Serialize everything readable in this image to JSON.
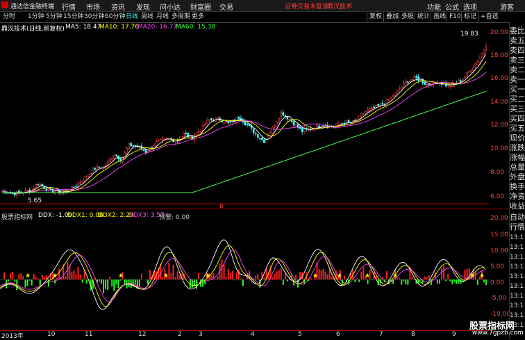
{
  "app": {
    "name": "通达信金融终端",
    "menus": [
      "行情",
      "市场",
      "资讯",
      "发现",
      "问小达",
      "财富圈",
      "交易"
    ],
    "notice": "证券交易未登录",
    "stock_link": "鼎汉技术",
    "right_menus": [
      "功能",
      "公式",
      "选项",
      "游客"
    ]
  },
  "periods": [
    "分时",
    "1分钟",
    "5分钟",
    "15分钟",
    "30分钟",
    "60分钟",
    "日线",
    "周线",
    "月线",
    "多周期",
    "更多"
  ],
  "active_period": "日线",
  "tools": [
    "复权",
    "叠加",
    "多股",
    "统计",
    "画线",
    "F10",
    "标记",
    "+自选"
  ],
  "kline": {
    "title": "鼎汉技术(日线,前复权)",
    "ma": [
      {
        "label": "MA5: 18.47",
        "color": "#ffffff"
      },
      {
        "label": "MA10: 17.76",
        "color": "#ffff00"
      },
      {
        "label": "MA20: 16.77",
        "color": "#ff44ff"
      },
      {
        "label": "MA60: 15.38",
        "color": "#44ff44"
      }
    ],
    "high_mark": "19.83",
    "low_mark": "5.65",
    "marker": "B"
  },
  "axis_price": [
    "20.00",
    "18.00",
    "16.00",
    "14.00",
    "12.00",
    "10.00",
    "8.00",
    "6.00"
  ],
  "axis_ind": [
    "20.00",
    "15.00",
    "10.00",
    "5.00",
    "0.00",
    "-5.00",
    "-10.00"
  ],
  "indicator": {
    "source": "股票指标网",
    "vals": [
      {
        "label": "DDX: -1.09",
        "color": "#ffffff"
      },
      {
        "label": "DDX1: 0.06",
        "color": "#ffff00"
      },
      {
        "label": "DDX2: 2.29",
        "color": "#ffff00"
      },
      {
        "label": "DDX3: 3.57",
        "color": "#ff44ff"
      },
      {
        "label": "预警: 0.00",
        "color": "#cccccc"
      }
    ]
  },
  "side": [
    "委比",
    "卖五",
    "卖四",
    "卖三",
    "卖二",
    "卖一",
    "买一",
    "买二",
    "买三",
    "买四",
    "买五",
    "现价",
    "涨跌",
    "涨幅",
    "总量",
    "外盘",
    "换手",
    "净资",
    "收益"
  ],
  "side2": [
    "自动",
    "行情",
    "13:1",
    "13:1",
    "13:1",
    "13:1",
    "13:1",
    "13:1",
    "13:1",
    "13:1",
    "13:1",
    "13:1"
  ],
  "dates": [
    "2013年",
    "10",
    "11",
    "12",
    "2",
    "3",
    "4",
    "5",
    "6",
    "7",
    "8",
    "9"
  ],
  "watermark": "股票指标网",
  "watermark_url": "www.7gpzb.com"
}
